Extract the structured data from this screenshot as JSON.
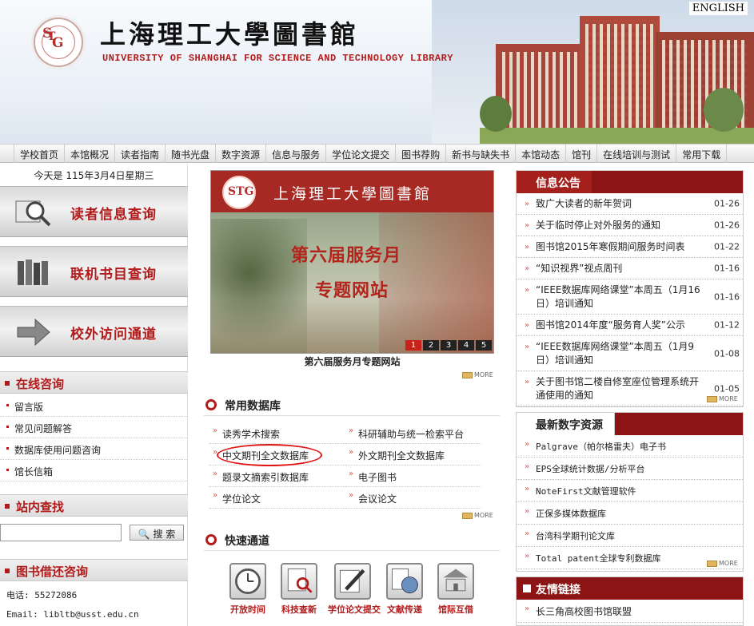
{
  "header": {
    "title_cn": "上海理工大學圖書館",
    "title_en": "UNIVERSITY OF SHANGHAI FOR SCIENCE AND TECHNOLOGY LIBRARY",
    "english_link": "ENGLISH",
    "seal_letters": "STG"
  },
  "nav": [
    "学校首页",
    "本馆概况",
    "读者指南",
    "随书光盘",
    "数字资源",
    "信息与服务",
    "学位论文提交",
    "图书荐购",
    "新书与缺失书",
    "本馆动态",
    "馆刊",
    "在线培训与测试",
    "常用下载"
  ],
  "left": {
    "date": "今天是 115年3月4日星期三",
    "quick_links": [
      {
        "label": "读者信息查询",
        "icon": "magnifier-icon"
      },
      {
        "label": "联机书目查询",
        "icon": "bookshelf-icon"
      },
      {
        "label": "校外访问通道",
        "icon": "arrow-icon"
      }
    ],
    "consult_title": "在线咨询",
    "consult_items": [
      "留言版",
      "常见问题解答",
      "数据库使用问题咨询",
      "馆长信箱"
    ],
    "search_title": "站内查找",
    "search_button": "搜 索",
    "loan_title": "图书借还咨询",
    "phone": "电话: 55272086",
    "email": "Email: libltb@usst.edu.cn"
  },
  "banner": {
    "library_name": "上海理工大學圖書館",
    "line1": "第六届服务月",
    "line2": "专题网站",
    "caption": "第六届服务月专题网站",
    "pages": [
      "1",
      "2",
      "3",
      "4",
      "5"
    ],
    "active_page": 0
  },
  "more_label": "MORE",
  "databases": {
    "title": "常用数据库",
    "items": [
      "读秀学术搜索",
      "科研辅助与统一检索平台",
      "中文期刊全文数据库",
      "外文期刊全文数据库",
      "题录文摘索引数据库",
      "电子图书",
      "学位论文",
      "会议论文"
    ]
  },
  "fast": {
    "title": "快速通道",
    "items": [
      {
        "label": "开放时间",
        "icon": "clock-icon"
      },
      {
        "label": "科技查新",
        "icon": "search-doc-icon"
      },
      {
        "label": "学位论文提交",
        "icon": "pen-icon"
      },
      {
        "label": "文献传递",
        "icon": "globe-icon"
      },
      {
        "label": "馆际互借",
        "icon": "library-icon"
      }
    ]
  },
  "notices": {
    "title": "信息公告",
    "items": [
      {
        "text": "致广大读者的新年贺词",
        "date": "01-26"
      },
      {
        "text": "关于临时停止对外服务的通知",
        "date": "01-26"
      },
      {
        "text": "图书馆2015年寒假期间服务时间表",
        "date": "01-22"
      },
      {
        "text": "“知识视界”视点周刊",
        "date": "01-16"
      },
      {
        "text": "“IEEE数据库网络课堂”本周五（1月16日）培训通知",
        "date": "01-16"
      },
      {
        "text": "图书馆2014年度“服务育人奖”公示",
        "date": "01-12"
      },
      {
        "text": "“IEEE数据库网络课堂”本周五（1月9日）培训通知",
        "date": "01-08"
      },
      {
        "text": "关于图书馆二楼自修室座位管理系统开通使用的通知",
        "date": "01-05"
      }
    ]
  },
  "resources": {
    "title": "最新数字资源",
    "items": [
      "Palgrave（帕尔格雷夫）电子书",
      "EPS全球统计数据/分析平台",
      "NoteFirst文献管理软件",
      "正保多媒体数据库",
      "台湾科学期刊论文库",
      "Total patent全球专利数据库"
    ]
  },
  "links": {
    "title": "友情链接",
    "items": [
      "长三角高校图书馆联盟"
    ]
  }
}
